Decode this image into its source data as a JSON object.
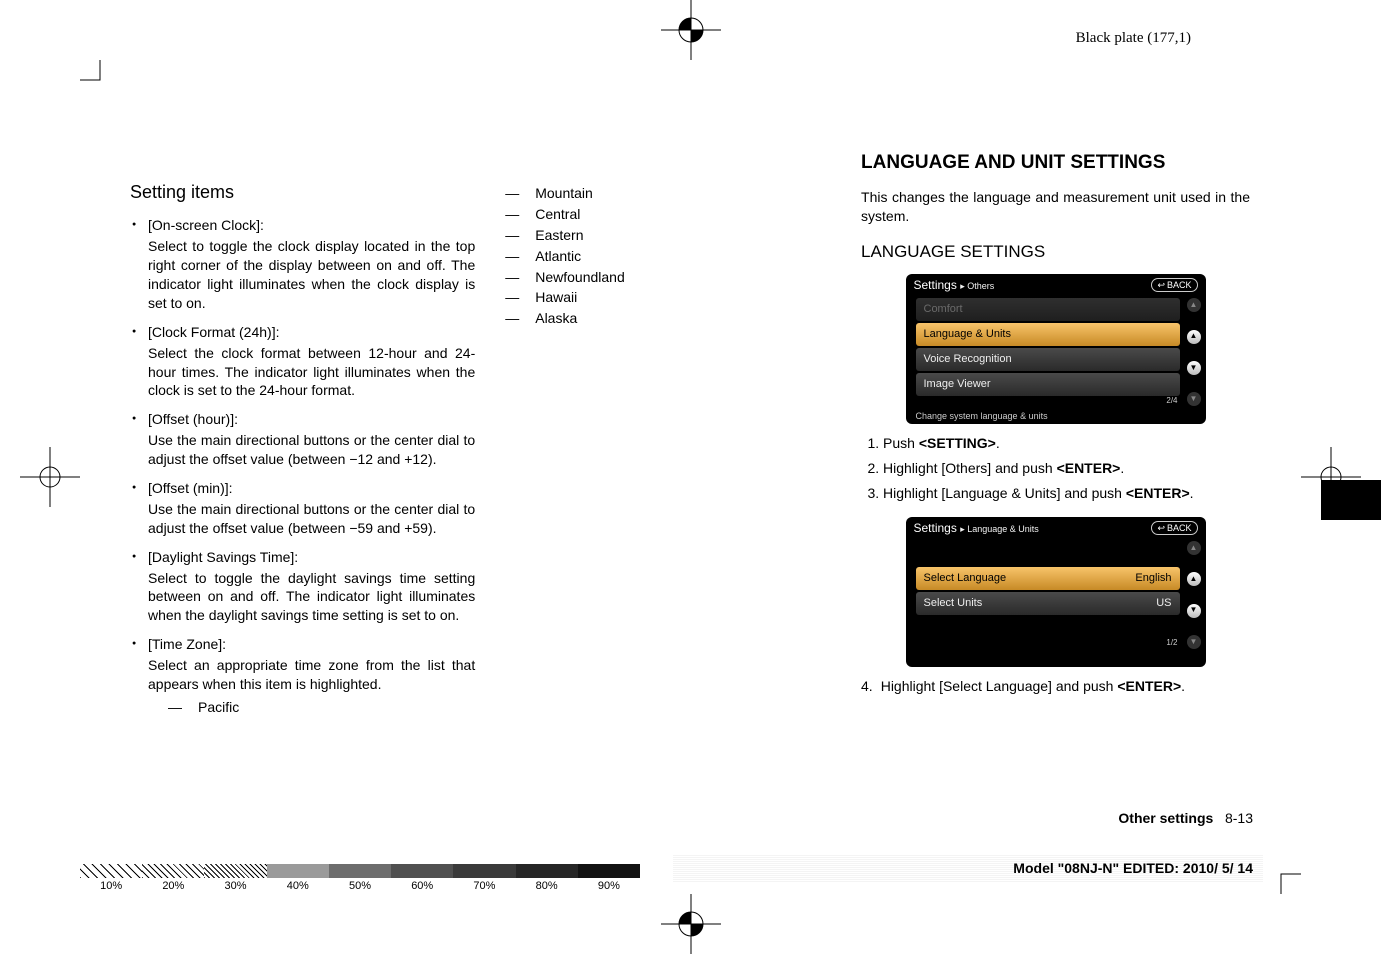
{
  "plate_info": "Black plate (177,1)",
  "left": {
    "heading": "Setting items",
    "items": [
      {
        "title": "[On-screen Clock]:",
        "desc": "Select to toggle the clock display located in the top right corner of the display between on and off. The indicator light illuminates when the clock display is set to on."
      },
      {
        "title": "[Clock Format (24h)]:",
        "desc": "Select the clock format between 12-hour and 24-hour times. The indicator light illuminates when the clock is set to the 24-hour format."
      },
      {
        "title": "[Offset (hour)]:",
        "desc": "Use the main directional buttons or the center dial to adjust the offset value (between −12 and +12)."
      },
      {
        "title": "[Offset (min)]:",
        "desc": "Use the main directional buttons or the center dial to adjust the offset value (between −59 and +59)."
      },
      {
        "title": "[Daylight Savings Time]:",
        "desc": "Select to toggle the daylight savings time setting between on and off. The indicator light illuminates when the daylight savings time setting is set to on."
      },
      {
        "title": "[Time Zone]:",
        "desc": "Select an appropriate time zone from the list that appears when this item is highlighted.",
        "sub": [
          "Pacific"
        ]
      }
    ]
  },
  "middle": {
    "zones": [
      "Mountain",
      "Central",
      "Eastern",
      "Atlantic",
      "Newfoundland",
      "Hawaii",
      "Alaska"
    ]
  },
  "right": {
    "section_title": "LANGUAGE AND UNIT SETTINGS",
    "section_desc": "This changes the language and measurement unit used in the system.",
    "subsection_title": "LANGUAGE SETTINGS",
    "shot1": {
      "title_main": "Settings",
      "title_crumb": "▸ Others",
      "back": "BACK",
      "rows": [
        {
          "label": "Comfort",
          "dim": true,
          "selected": false
        },
        {
          "label": "Language & Units",
          "dim": false,
          "selected": true
        },
        {
          "label": "Voice Recognition",
          "dim": false,
          "selected": false
        },
        {
          "label": "Image Viewer",
          "dim": false,
          "selected": false
        }
      ],
      "page_ind": "2/4",
      "footer": "Change system language & units"
    },
    "steps1": [
      "Push <SETTING>.",
      "Highlight [Others] and push <ENTER>.",
      "Highlight [Language & Units] and push <ENTER>."
    ],
    "shot2": {
      "title_main": "Settings",
      "title_crumb": "▸ Language & Units",
      "back": "BACK",
      "rows": [
        {
          "label": "Select Language",
          "value": "English",
          "selected": true
        },
        {
          "label": "Select Units",
          "value": "US",
          "selected": false
        }
      ],
      "page_ind": "1/2"
    },
    "step4_num": "4.",
    "step4": "Highlight [Select Language] and push <ENTER>."
  },
  "footer_section": "Other settings",
  "footer_page": "8-13",
  "model_line": "Model \"08NJ-N\" EDITED: 2010/ 5/ 14",
  "percents": [
    "10%",
    "20%",
    "30%",
    "40%",
    "50%",
    "60%",
    "70%",
    "80%",
    "90%"
  ]
}
